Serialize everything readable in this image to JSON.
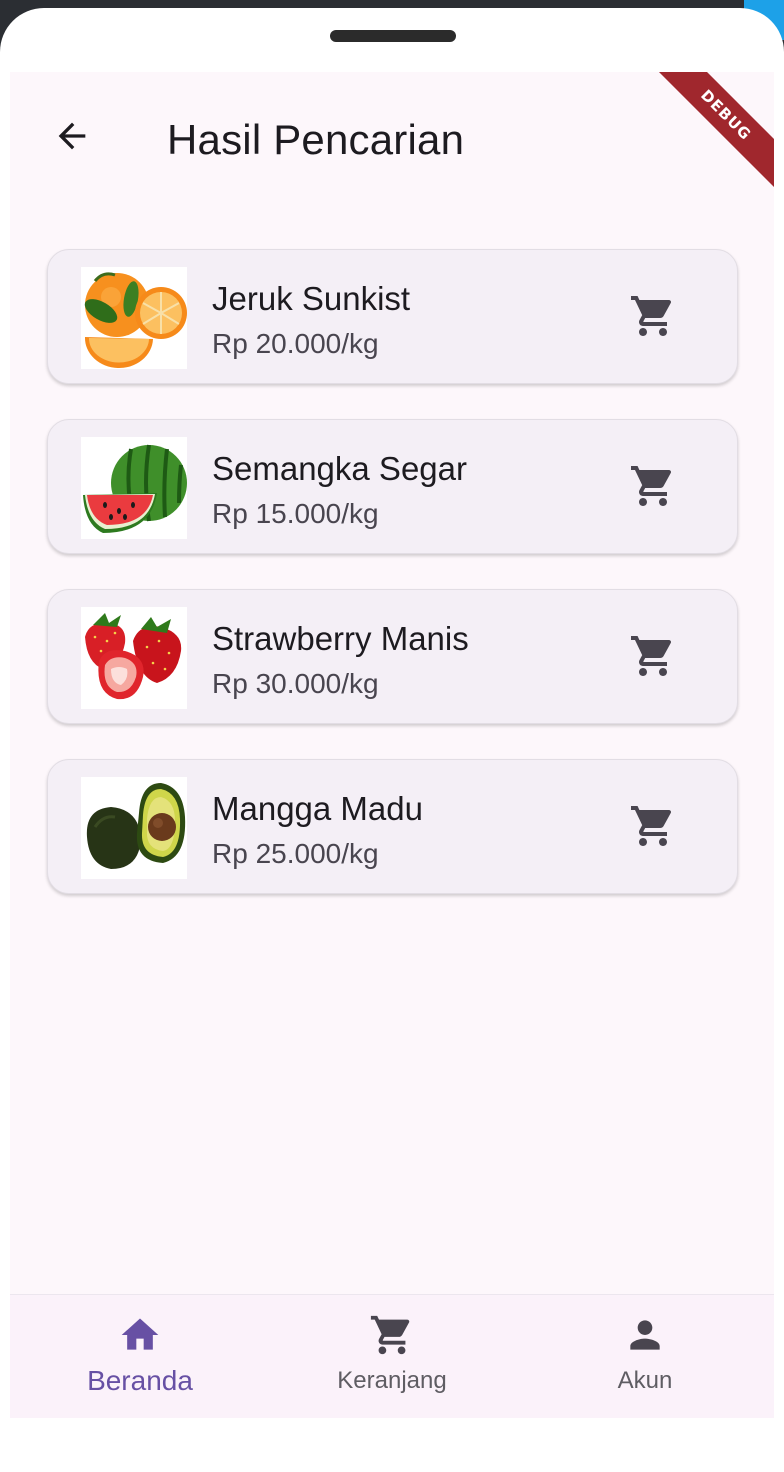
{
  "app": {
    "title": "Hasil Pencarian",
    "debug_banner": "DEBUG"
  },
  "results": [
    {
      "name": "Jeruk Sunkist",
      "price": "Rp 20.000/kg",
      "image": "orange"
    },
    {
      "name": "Semangka Segar",
      "price": "Rp 15.000/kg",
      "image": "watermelon"
    },
    {
      "name": "Strawberry Manis",
      "price": "Rp 30.000/kg",
      "image": "strawberry"
    },
    {
      "name": "Mangga Madu",
      "price": "Rp 25.000/kg",
      "image": "avocado"
    }
  ],
  "bottom_nav": {
    "items": [
      {
        "label": "Beranda",
        "icon": "home-icon",
        "active": true
      },
      {
        "label": "Keranjang",
        "icon": "cart-icon",
        "active": false
      },
      {
        "label": "Akun",
        "icon": "person-icon",
        "active": false
      }
    ]
  },
  "colors": {
    "accent": "#6750a4",
    "icon": "#49454f",
    "card_bg": "#f4eff6",
    "screen_bg": "#fdf7fb",
    "debug_ribbon": "#a0272d"
  }
}
